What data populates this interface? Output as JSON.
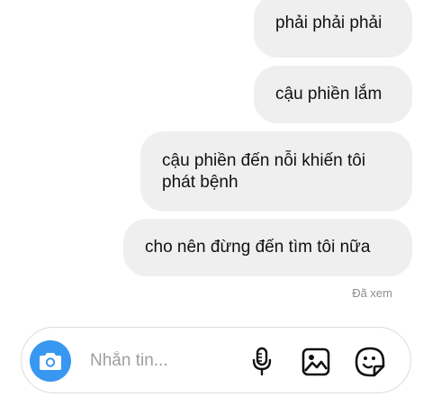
{
  "messages": [
    {
      "text": "phải phải phải"
    },
    {
      "text": "cậu phiền lắm"
    },
    {
      "text": "cậu phiền đến nỗi khiến tôi phát bệnh"
    },
    {
      "text": "cho nên đừng đến tìm tôi nữa"
    }
  ],
  "status": {
    "seen_label": "Đã xem"
  },
  "composer": {
    "placeholder": "Nhắn tin...",
    "value": "",
    "camera_icon": "camera-icon",
    "mic_icon": "microphone-icon",
    "gallery_icon": "image-gallery-icon",
    "sticker_icon": "sticker-icon",
    "accent_color": "#3897f0"
  }
}
